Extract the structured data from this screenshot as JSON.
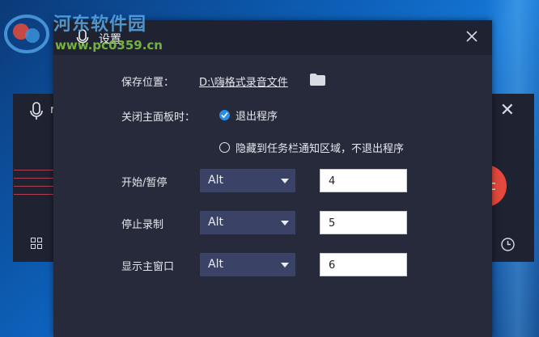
{
  "watermark": {
    "site_name": "河东软件园",
    "url": "www.pc0359.cn"
  },
  "main_window": {
    "title_fragment": "r",
    "close_symbol": "✕"
  },
  "dialog": {
    "title": "设置",
    "close_symbol": "✕",
    "save_location": {
      "label": "保存位置：",
      "path": "D:\\嗨格式录音文件"
    },
    "on_close": {
      "label": "关闭主面板时：",
      "options": [
        {
          "text": "退出程序",
          "selected": true
        },
        {
          "text": "隐藏到任务栏通知区域，不退出程序",
          "selected": false
        }
      ]
    },
    "hotkeys": [
      {
        "label": "开始/暂停",
        "modifier": "Alt",
        "key": "4"
      },
      {
        "label": "停止录制",
        "modifier": "Alt",
        "key": "5"
      },
      {
        "label": "显示主窗口",
        "modifier": "Alt",
        "key": "6"
      }
    ]
  },
  "colors": {
    "accent": "#2a8de6",
    "record": "#e5483d",
    "dialog_bg": "#262a3a",
    "select_bg": "#3a4266"
  }
}
